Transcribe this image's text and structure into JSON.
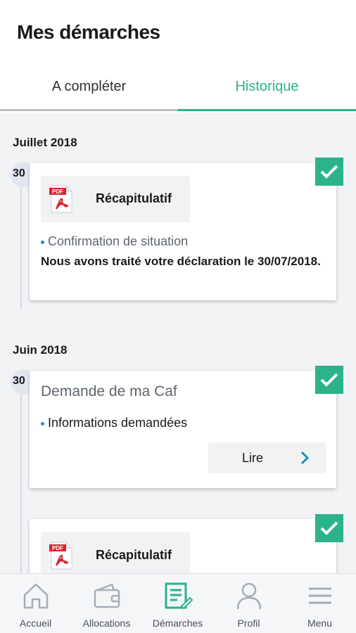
{
  "header": {
    "title": "Mes démarches",
    "tabs": [
      {
        "label": "A compléter",
        "active": false
      },
      {
        "label": "Historique",
        "active": true
      }
    ]
  },
  "timeline": [
    {
      "month": "Juillet 2018",
      "entries": [
        {
          "day": "30",
          "status": "check-icon",
          "document_label": "Récapitulatif",
          "subtitle": "Confirmation de situation",
          "description": "Nous avons traité votre déclaration le 30/07/2018."
        }
      ]
    },
    {
      "month": "Juin 2018",
      "entries": [
        {
          "day": "30",
          "status": "check-icon",
          "title": "Demande de ma Caf",
          "info": "Informations demandées",
          "action_label": "Lire"
        },
        {
          "status": "check-icon",
          "document_label": "Récapitulatif"
        }
      ]
    }
  ],
  "bottom_nav": [
    {
      "label": "Accueil",
      "icon": "home-icon",
      "active": false
    },
    {
      "label": "Allocations",
      "icon": "wallet-icon",
      "active": false
    },
    {
      "label": "Démarches",
      "icon": "document-edit-icon",
      "active": true
    },
    {
      "label": "Profil",
      "icon": "user-icon",
      "active": false
    },
    {
      "label": "Menu",
      "icon": "menu-icon",
      "active": false
    }
  ],
  "colors": {
    "accent": "#2cb38b",
    "bullet": "#1a8fd0",
    "chevron": "#1a8fd0",
    "pdf_red": "#d9232e"
  }
}
